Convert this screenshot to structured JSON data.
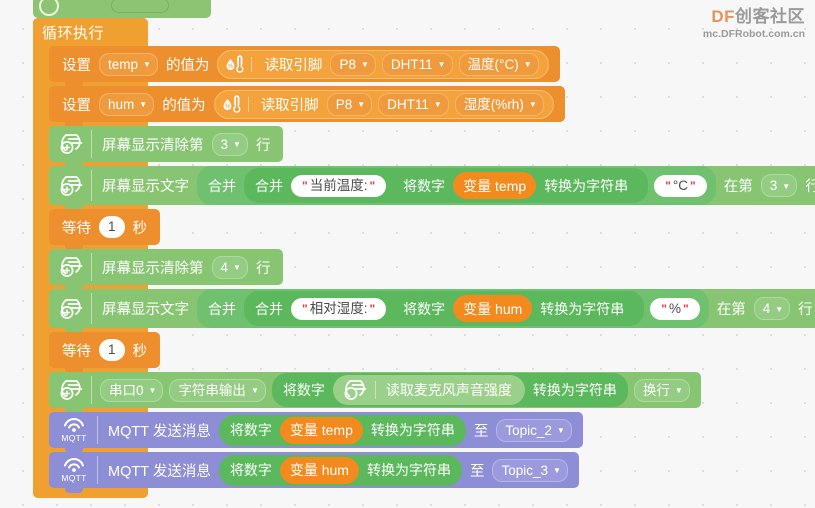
{
  "watermark": {
    "brand_df": "DF",
    "brand_rest": "创客社区",
    "url": "mc.DFRobot.com.cn"
  },
  "canvas": {
    "background_color": "#f7f7f7",
    "dot_color": "#dcdcdc"
  },
  "palette": {
    "loop_orange": "#f0a030",
    "variable_orange": "#ee8f2e",
    "display_green": "#88c573",
    "mqtt_purple": "#8e8ed6",
    "string_green": "#5cb85c",
    "quote_red": "#e03b3b"
  },
  "loop": {
    "label": "循环执行"
  },
  "blocks": [
    {
      "id": "set-temp",
      "kind": "variable-set",
      "color": "orange",
      "set_label": "设置",
      "variable": "temp",
      "value_label": "的值为",
      "sensor": {
        "icon": "dht-sensor-icon",
        "read_pin_label": "读取引脚",
        "pin": "P8",
        "module": "DHT11",
        "measure": "温度(°C)"
      }
    },
    {
      "id": "set-hum",
      "kind": "variable-set",
      "color": "orange",
      "set_label": "设置",
      "variable": "hum",
      "value_label": "的值为",
      "sensor": {
        "icon": "dht-sensor-icon",
        "read_pin_label": "读取引脚",
        "pin": "P8",
        "module": "DHT11",
        "measure": "湿度(%rh)"
      }
    },
    {
      "id": "clear-line-3",
      "kind": "screen-clear",
      "color": "green",
      "icon": "screen-display-icon",
      "prefix": "屏幕显示清除第",
      "line": "3",
      "suffix": "行"
    },
    {
      "id": "show-temp",
      "kind": "screen-show-text",
      "color": "green",
      "icon": "screen-display-icon",
      "prefix": "屏幕显示文字",
      "join_outer": "合并",
      "join_inner": "合并",
      "text1": "当前温度:",
      "num2str_label": "将数字",
      "variable_label": "变量 temp",
      "convert_label": "转换为字符串",
      "text2": "°C",
      "at_label": "在第",
      "line": "3",
      "suffix": "行"
    },
    {
      "id": "wait-1-a",
      "kind": "wait",
      "color": "orange",
      "prefix": "等待",
      "seconds": "1",
      "suffix": "秒"
    },
    {
      "id": "clear-line-4",
      "kind": "screen-clear",
      "color": "green",
      "icon": "screen-display-icon",
      "prefix": "屏幕显示清除第",
      "line": "4",
      "suffix": "行"
    },
    {
      "id": "show-hum",
      "kind": "screen-show-text",
      "color": "green",
      "icon": "screen-display-icon",
      "prefix": "屏幕显示文字",
      "join_outer": "合并",
      "join_inner": "合并",
      "text1": "相对湿度:",
      "num2str_label": "将数字",
      "variable_label": "变量 hum",
      "convert_label": "转换为字符串",
      "text2": "%",
      "at_label": "在第",
      "line": "4",
      "suffix": "行"
    },
    {
      "id": "wait-1-b",
      "kind": "wait",
      "color": "orange",
      "prefix": "等待",
      "seconds": "1",
      "suffix": "秒"
    },
    {
      "id": "serial-print",
      "kind": "serial-output",
      "color": "green",
      "icon": "screen-display-icon",
      "port": "串口0",
      "mode": "字符串输出",
      "num2str_label": "将数字",
      "sensor_icon": "microphone-sensor-icon",
      "sensor_label": "读取麦克风声音强度",
      "convert_label": "转换为字符串",
      "newline": "换行"
    },
    {
      "id": "mqtt-temp",
      "kind": "mqtt-publish",
      "color": "purple",
      "icon": "mqtt-icon",
      "icon_text": "MQTT",
      "prefix": "MQTT 发送消息",
      "num2str_label": "将数字",
      "variable_label": "变量 temp",
      "convert_label": "转换为字符串",
      "to_label": "至",
      "topic": "Topic_2"
    },
    {
      "id": "mqtt-hum",
      "kind": "mqtt-publish",
      "color": "purple",
      "icon": "mqtt-icon",
      "icon_text": "MQTT",
      "prefix": "MQTT 发送消息",
      "num2str_label": "将数字",
      "variable_label": "变量 hum",
      "convert_label": "转换为字符串",
      "to_label": "至",
      "topic": "Topic_3"
    }
  ]
}
